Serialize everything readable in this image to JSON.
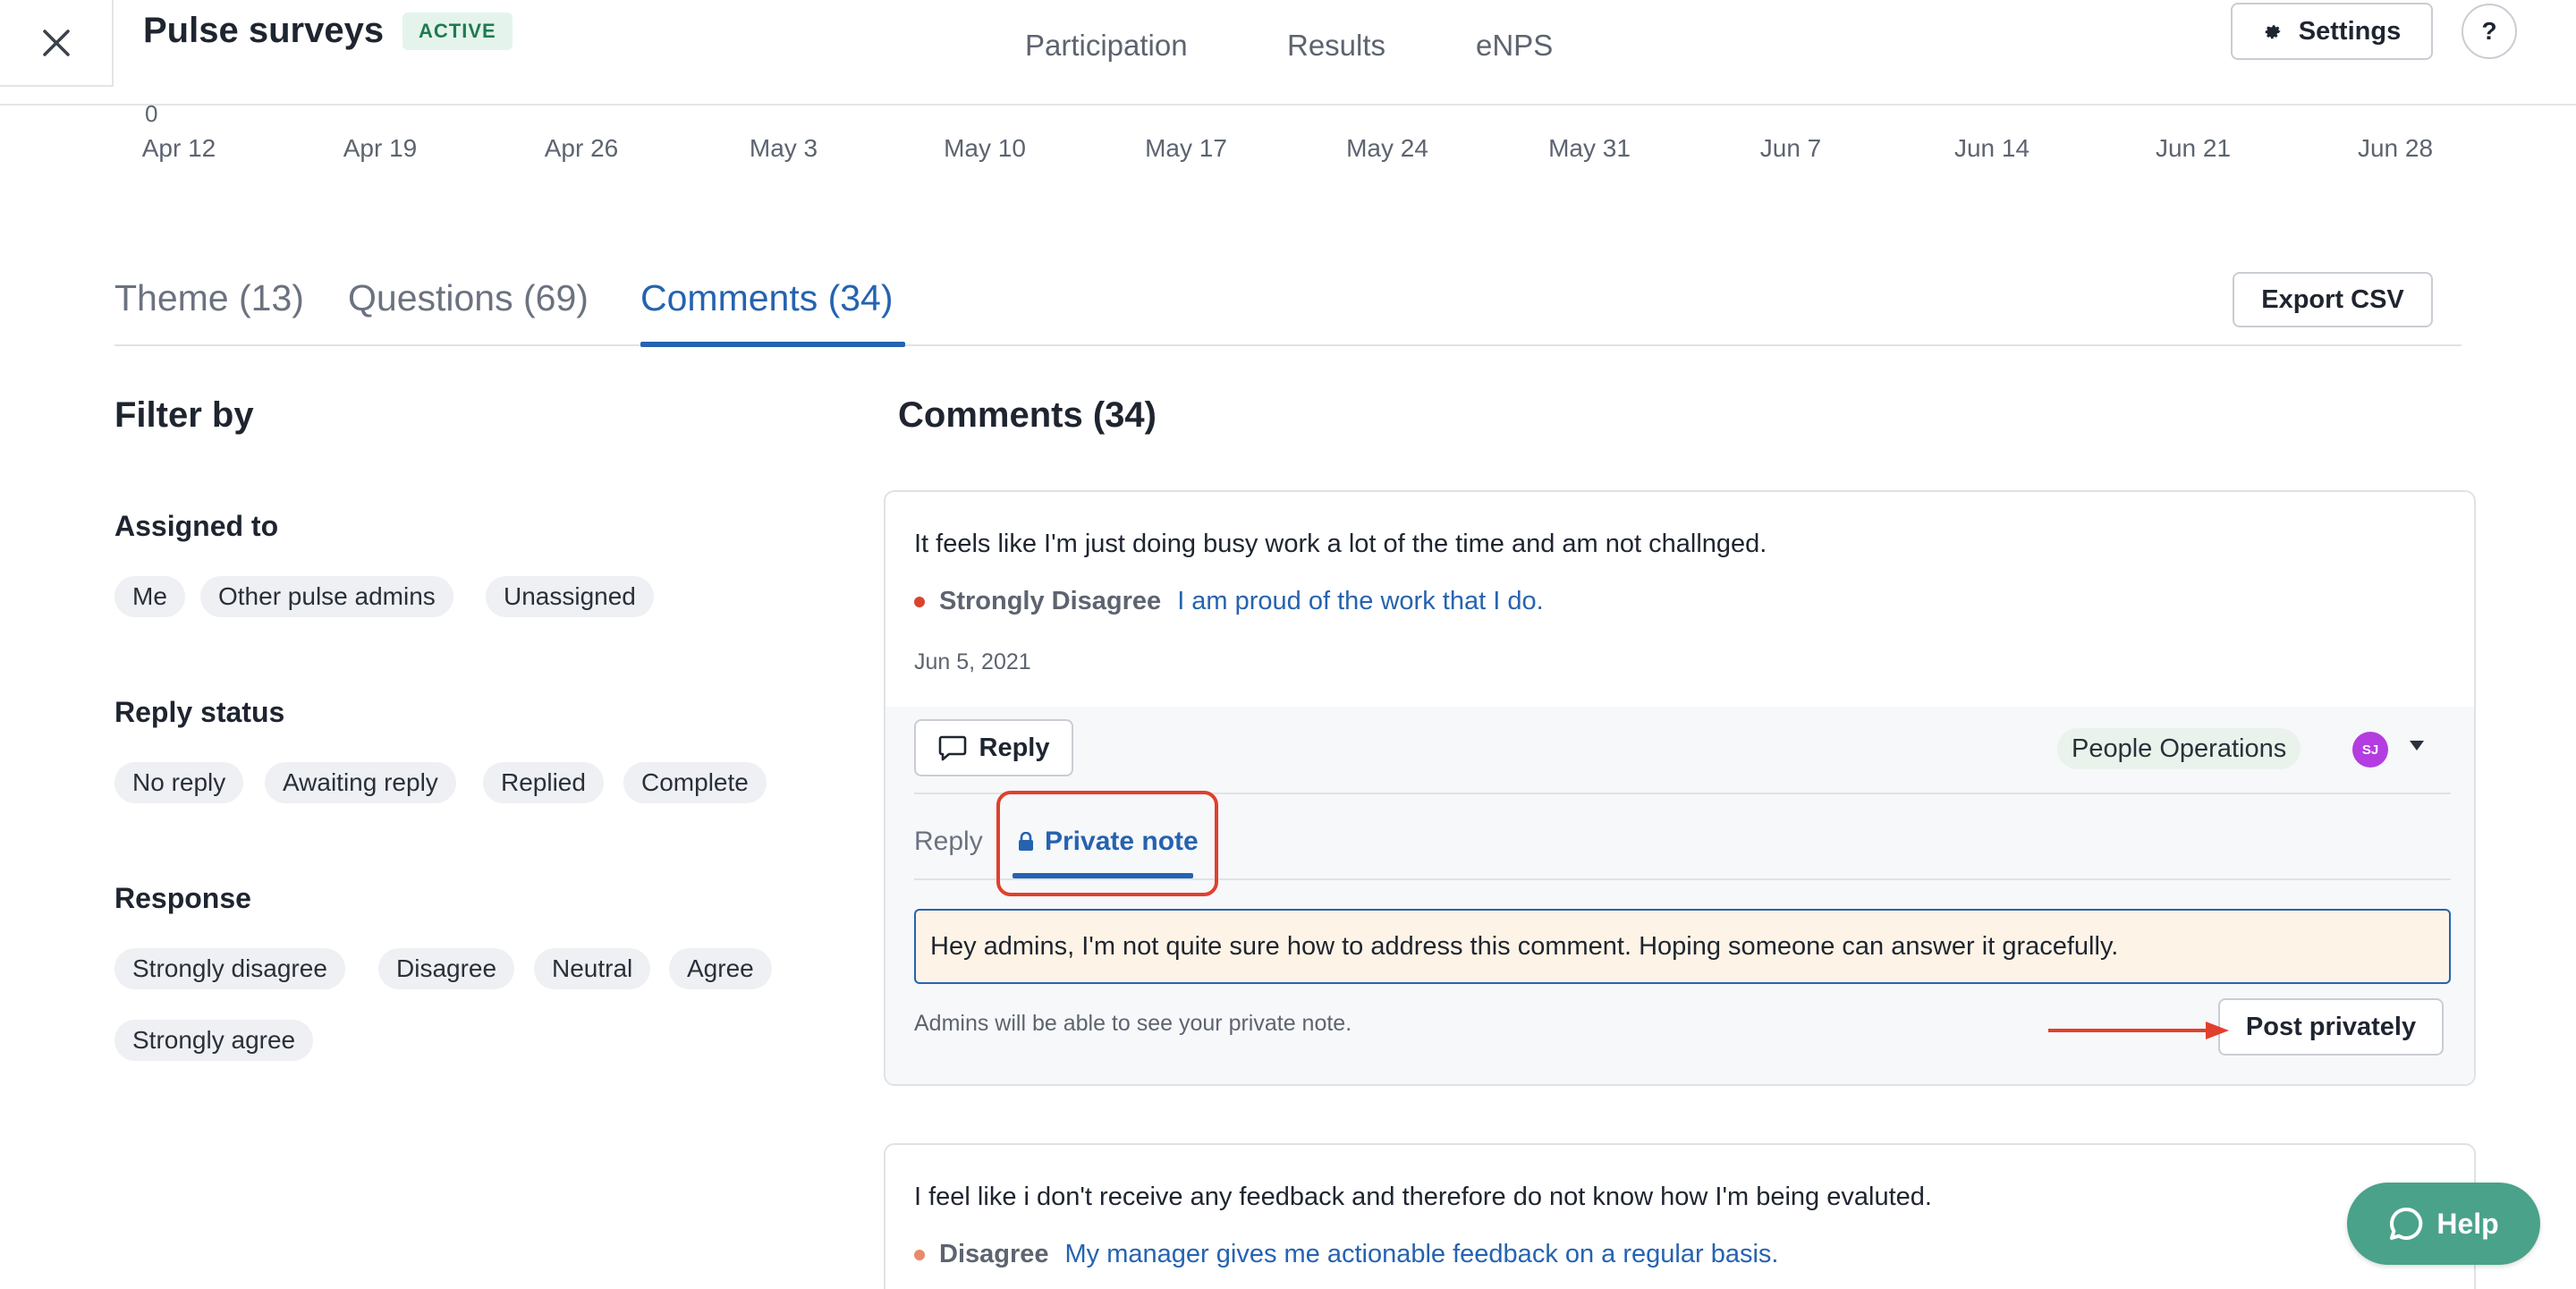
{
  "header": {
    "title": "Pulse surveys",
    "status_badge": "ACTIVE",
    "nav": [
      "Participation",
      "Results",
      "eNPS"
    ],
    "settings_label": "Settings",
    "help_label": "?"
  },
  "axis": {
    "zero_label": "0",
    "ticks": [
      "Apr 12",
      "Apr 19",
      "Apr 26",
      "May 3",
      "May 10",
      "May 17",
      "May 24",
      "May 31",
      "Jun 7",
      "Jun 14",
      "Jun 21",
      "Jun 28"
    ]
  },
  "tabs": {
    "items": [
      {
        "label": "Theme (13)",
        "active": false
      },
      {
        "label": "Questions (69)",
        "active": false
      },
      {
        "label": "Comments (34)",
        "active": true
      }
    ],
    "export_label": "Export CSV"
  },
  "filters": {
    "title": "Filter by",
    "groups": [
      {
        "heading": "Assigned to",
        "chips": [
          "Me",
          "Other pulse admins",
          "Unassigned"
        ]
      },
      {
        "heading": "Reply status",
        "chips": [
          "No reply",
          "Awaiting reply",
          "Replied",
          "Complete"
        ]
      },
      {
        "heading": "Response",
        "chips": [
          "Strongly disagree",
          "Disagree",
          "Neutral",
          "Agree",
          "Strongly agree"
        ]
      }
    ]
  },
  "comments": {
    "title": "Comments (34)",
    "items": [
      {
        "text": "It feels like I'm just doing busy work a lot of the time and am not challnged.",
        "response": "Strongly Disagree",
        "response_color": "#d9442f",
        "question": "I am proud of the work that I do.",
        "date": "Jun 5, 2021",
        "reply_button": "Reply",
        "department": "People Operations",
        "avatar_initials": "SJ",
        "subtabs": [
          "Reply",
          "Private note"
        ],
        "note_value": "Hey admins, I'm not quite sure how to address this comment. Hoping someone can answer it gracefully.",
        "hint": "Admins will be able to see your private note.",
        "post_button": "Post privately"
      },
      {
        "text": "I feel like i don't receive any feedback and therefore do not know how I'm being evaluted.",
        "response": "Disagree",
        "response_color": "#e98a6a",
        "question": "My manager gives me actionable feedback on a regular basis."
      }
    ]
  },
  "help_fab": {
    "label": "Help"
  },
  "colors": {
    "accent": "#2563b0",
    "highlight": "#e0402e",
    "help": "#4aa28a"
  }
}
